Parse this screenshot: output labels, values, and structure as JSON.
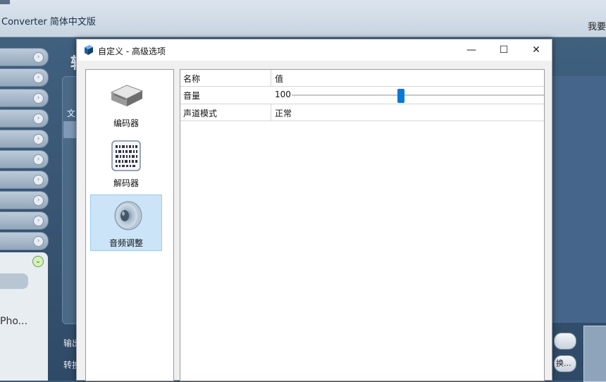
{
  "background_app": {
    "title": "Converter 简体中文版",
    "top_right_text": "我要",
    "big_char": "转",
    "list_header": "文",
    "output_label": "输出",
    "convert_label": "转换",
    "panel_text": "Pho...",
    "btn2_label": "换..."
  },
  "dialog": {
    "title": "自定义 - 高级选项",
    "window_buttons": {
      "minimize": "—",
      "maximize": "☐",
      "close": "✕"
    },
    "nav": [
      {
        "label": "编码器",
        "icon": "encoder-icon",
        "selected": false
      },
      {
        "label": "解码器",
        "icon": "decoder-icon",
        "selected": false
      },
      {
        "label": "音频调整",
        "icon": "speaker-icon",
        "selected": true
      }
    ],
    "grid": {
      "header": {
        "name": "名称",
        "value": "值"
      },
      "rows": [
        {
          "name": "音量",
          "value": "100",
          "slider_fraction": 0.43
        },
        {
          "name": "声道模式",
          "value": "正常"
        }
      ]
    }
  },
  "colors": {
    "accent": "#0a78d7",
    "selection": "#cce4f7"
  }
}
